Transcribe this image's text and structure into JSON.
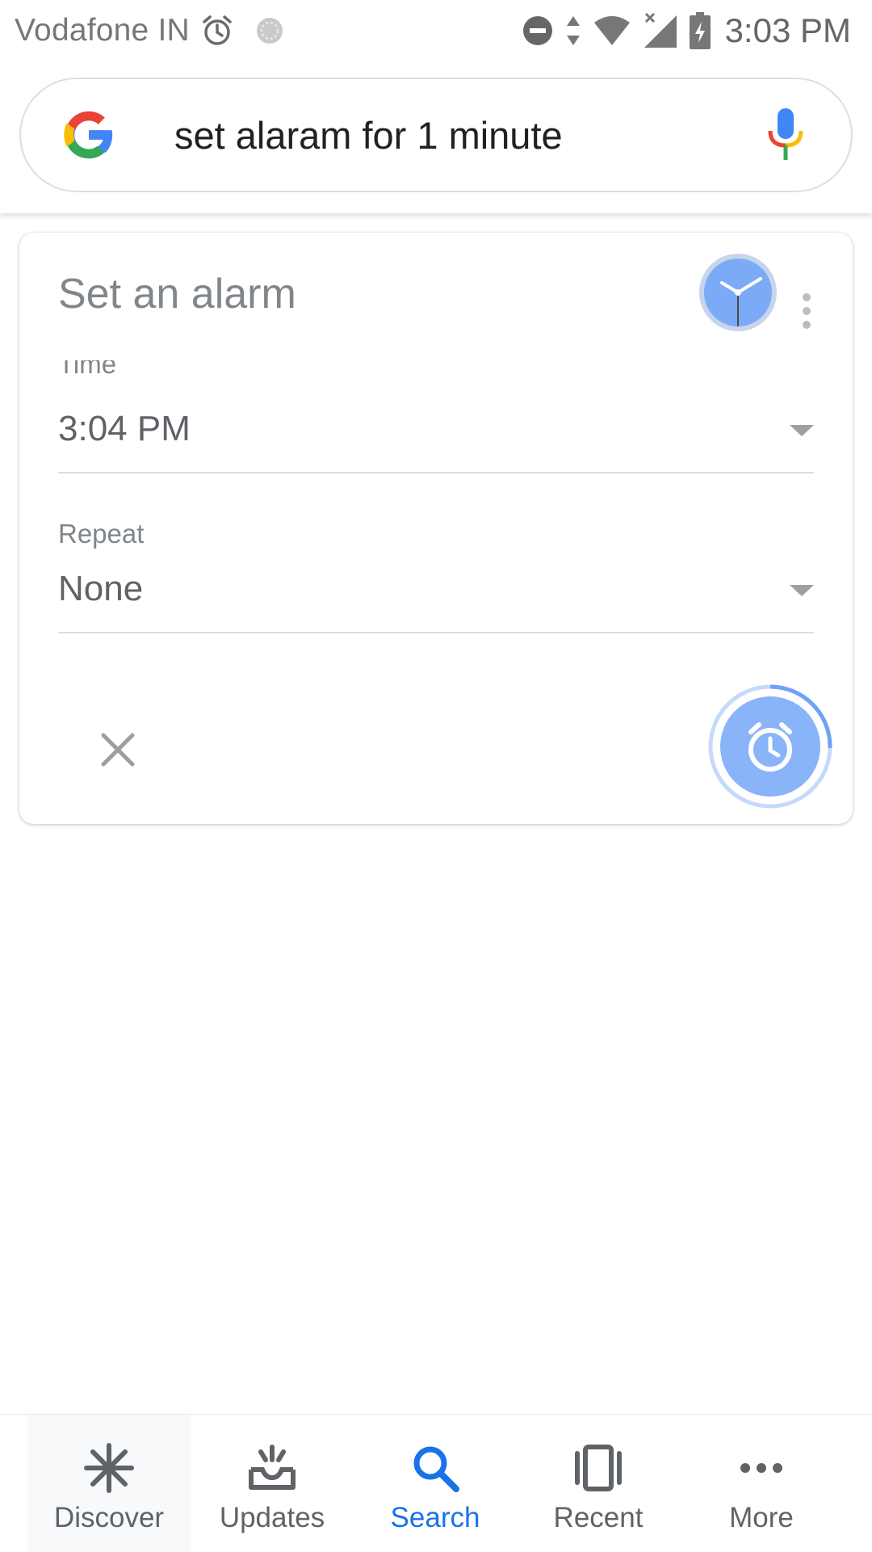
{
  "status_bar": {
    "carrier": "Vodafone IN",
    "time": "3:03 PM",
    "icons": [
      "alarm-icon",
      "sync-icon",
      "do-not-disturb-icon",
      "data-arrows-icon",
      "wifi-icon",
      "cell-signal-icon",
      "battery-charging-icon"
    ]
  },
  "search": {
    "query": "set alaram for 1 minute",
    "icons": [
      "google-logo",
      "mic-icon"
    ]
  },
  "alarm_card": {
    "title": "Set an alarm",
    "time_label": "Time",
    "time_value": "3:04 PM",
    "repeat_label": "Repeat",
    "repeat_value": "None",
    "icons": [
      "clock-app-icon",
      "more-vert-icon",
      "close-icon",
      "alarm-add-icon"
    ],
    "colors": {
      "accent": "#7baaf7",
      "fab": "#8ab4f8"
    }
  },
  "bottom_nav": {
    "items": [
      {
        "label": "Discover",
        "icon": "asterisk-icon"
      },
      {
        "label": "Updates",
        "icon": "inbox-updates-icon"
      },
      {
        "label": "Search",
        "icon": "search-icon",
        "active": true
      },
      {
        "label": "Recent",
        "icon": "recent-cards-icon"
      },
      {
        "label": "More",
        "icon": "more-horiz-icon"
      }
    ],
    "colors": {
      "active": "#1a73e8",
      "inactive": "#5f6368"
    }
  }
}
